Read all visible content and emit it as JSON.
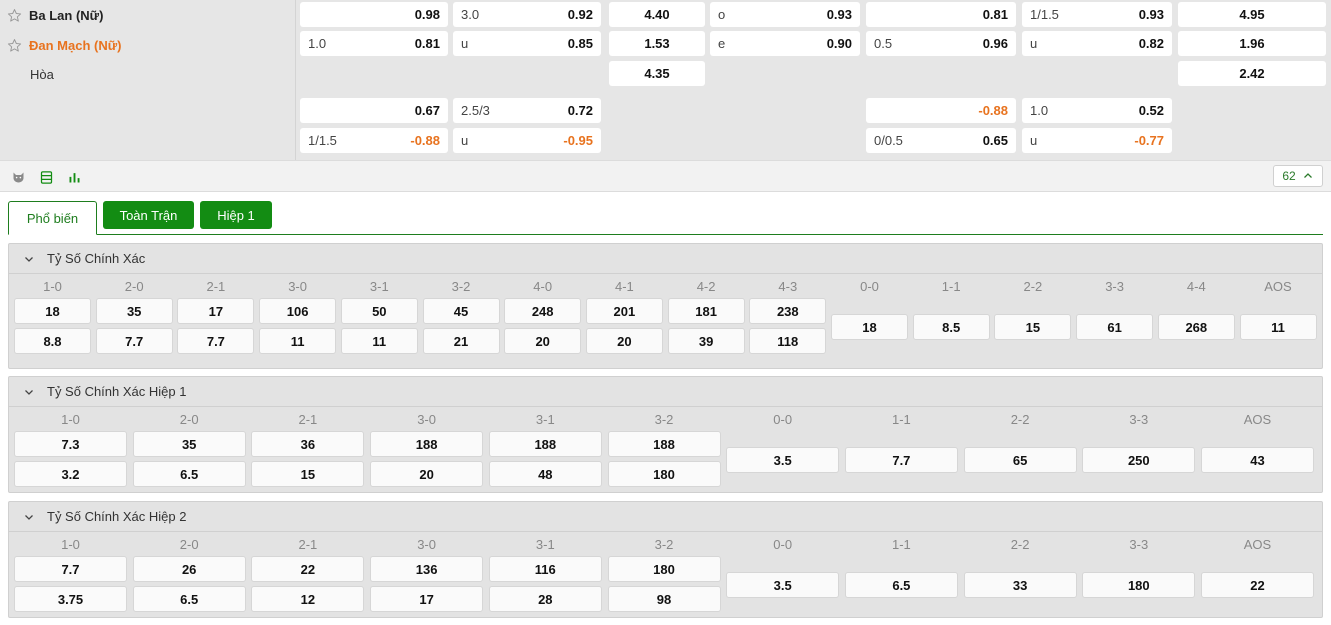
{
  "teams": {
    "home": "Ba Lan (Nữ)",
    "away": "Đan Mạch (Nữ)",
    "draw": "Hòa"
  },
  "top_odds": {
    "row1": [
      {
        "l": "",
        "r": "0.98"
      },
      {
        "l": "3.0",
        "r": "0.92"
      },
      {
        "c": "4.40"
      },
      {
        "l": "o",
        "r": "0.93"
      },
      {
        "l": "",
        "r": "0.81"
      },
      {
        "l": "1/1.5",
        "r": "0.93"
      },
      {
        "c": "4.95"
      }
    ],
    "row2": [
      {
        "l": "1.0",
        "r": "0.81"
      },
      {
        "l": "u",
        "r": "0.85"
      },
      {
        "c": "1.53"
      },
      {
        "l": "e",
        "r": "0.90"
      },
      {
        "l": "0.5",
        "r": "0.96"
      },
      {
        "l": "u",
        "r": "0.82"
      },
      {
        "c": "1.96"
      }
    ],
    "row3": [
      {
        "c": "4.35"
      },
      {
        "c": "2.42"
      }
    ],
    "row4": [
      {
        "l": "",
        "r": "0.67"
      },
      {
        "l": "2.5/3",
        "r": "0.72"
      },
      {
        "l": "",
        "r": "-0.88"
      },
      {
        "l": "1.0",
        "r": "0.52"
      }
    ],
    "row5": [
      {
        "l": "1/1.5",
        "r": "-0.88"
      },
      {
        "l": "u",
        "r": "-0.95"
      },
      {
        "l": "0/0.5",
        "r": "0.65"
      },
      {
        "l": "u",
        "r": "-0.77"
      }
    ]
  },
  "toolbar": {
    "icons": [
      "fox-icon",
      "list-icon",
      "bar-chart-icon"
    ],
    "collapse_count": "62",
    "accent": "#138c13"
  },
  "tabs": [
    "Phổ biến",
    "Toàn Trận",
    "Hiệp 1"
  ],
  "sections": [
    {
      "title": "Tỷ Số Chính Xác",
      "scores": [
        "1-0",
        "2-0",
        "2-1",
        "3-0",
        "3-1",
        "3-2",
        "4-0",
        "4-1",
        "4-2",
        "4-3"
      ],
      "home": [
        "18",
        "35",
        "17",
        "106",
        "50",
        "45",
        "248",
        "201",
        "181",
        "238"
      ],
      "away": [
        "8.8",
        "7.7",
        "7.7",
        "11",
        "11",
        "21",
        "20",
        "20",
        "39",
        "118"
      ],
      "draws": [
        "0-0",
        "1-1",
        "2-2",
        "3-3",
        "4-4",
        "AOS"
      ],
      "draw_odds": [
        "18",
        "8.5",
        "15",
        "61",
        "268",
        "11"
      ]
    },
    {
      "title": "Tỷ Số Chính Xác Hiệp 1",
      "scores": [
        "1-0",
        "2-0",
        "2-1",
        "3-0",
        "3-1",
        "3-2"
      ],
      "home": [
        "7.3",
        "35",
        "36",
        "188",
        "188",
        "188"
      ],
      "away": [
        "3.2",
        "6.5",
        "15",
        "20",
        "48",
        "180"
      ],
      "draws": [
        "0-0",
        "1-1",
        "2-2",
        "3-3",
        "AOS"
      ],
      "draw_odds": [
        "3.5",
        "7.7",
        "65",
        "250",
        "43"
      ]
    },
    {
      "title": "Tỷ Số Chính Xác Hiệp 2",
      "scores": [
        "1-0",
        "2-0",
        "2-1",
        "3-0",
        "3-1",
        "3-2"
      ],
      "home": [
        "7.7",
        "26",
        "22",
        "136",
        "116",
        "180"
      ],
      "away": [
        "3.75",
        "6.5",
        "12",
        "17",
        "28",
        "98"
      ],
      "draws": [
        "0-0",
        "1-1",
        "2-2",
        "3-3",
        "AOS"
      ],
      "draw_odds": [
        "3.5",
        "6.5",
        "33",
        "180",
        "22"
      ]
    }
  ]
}
